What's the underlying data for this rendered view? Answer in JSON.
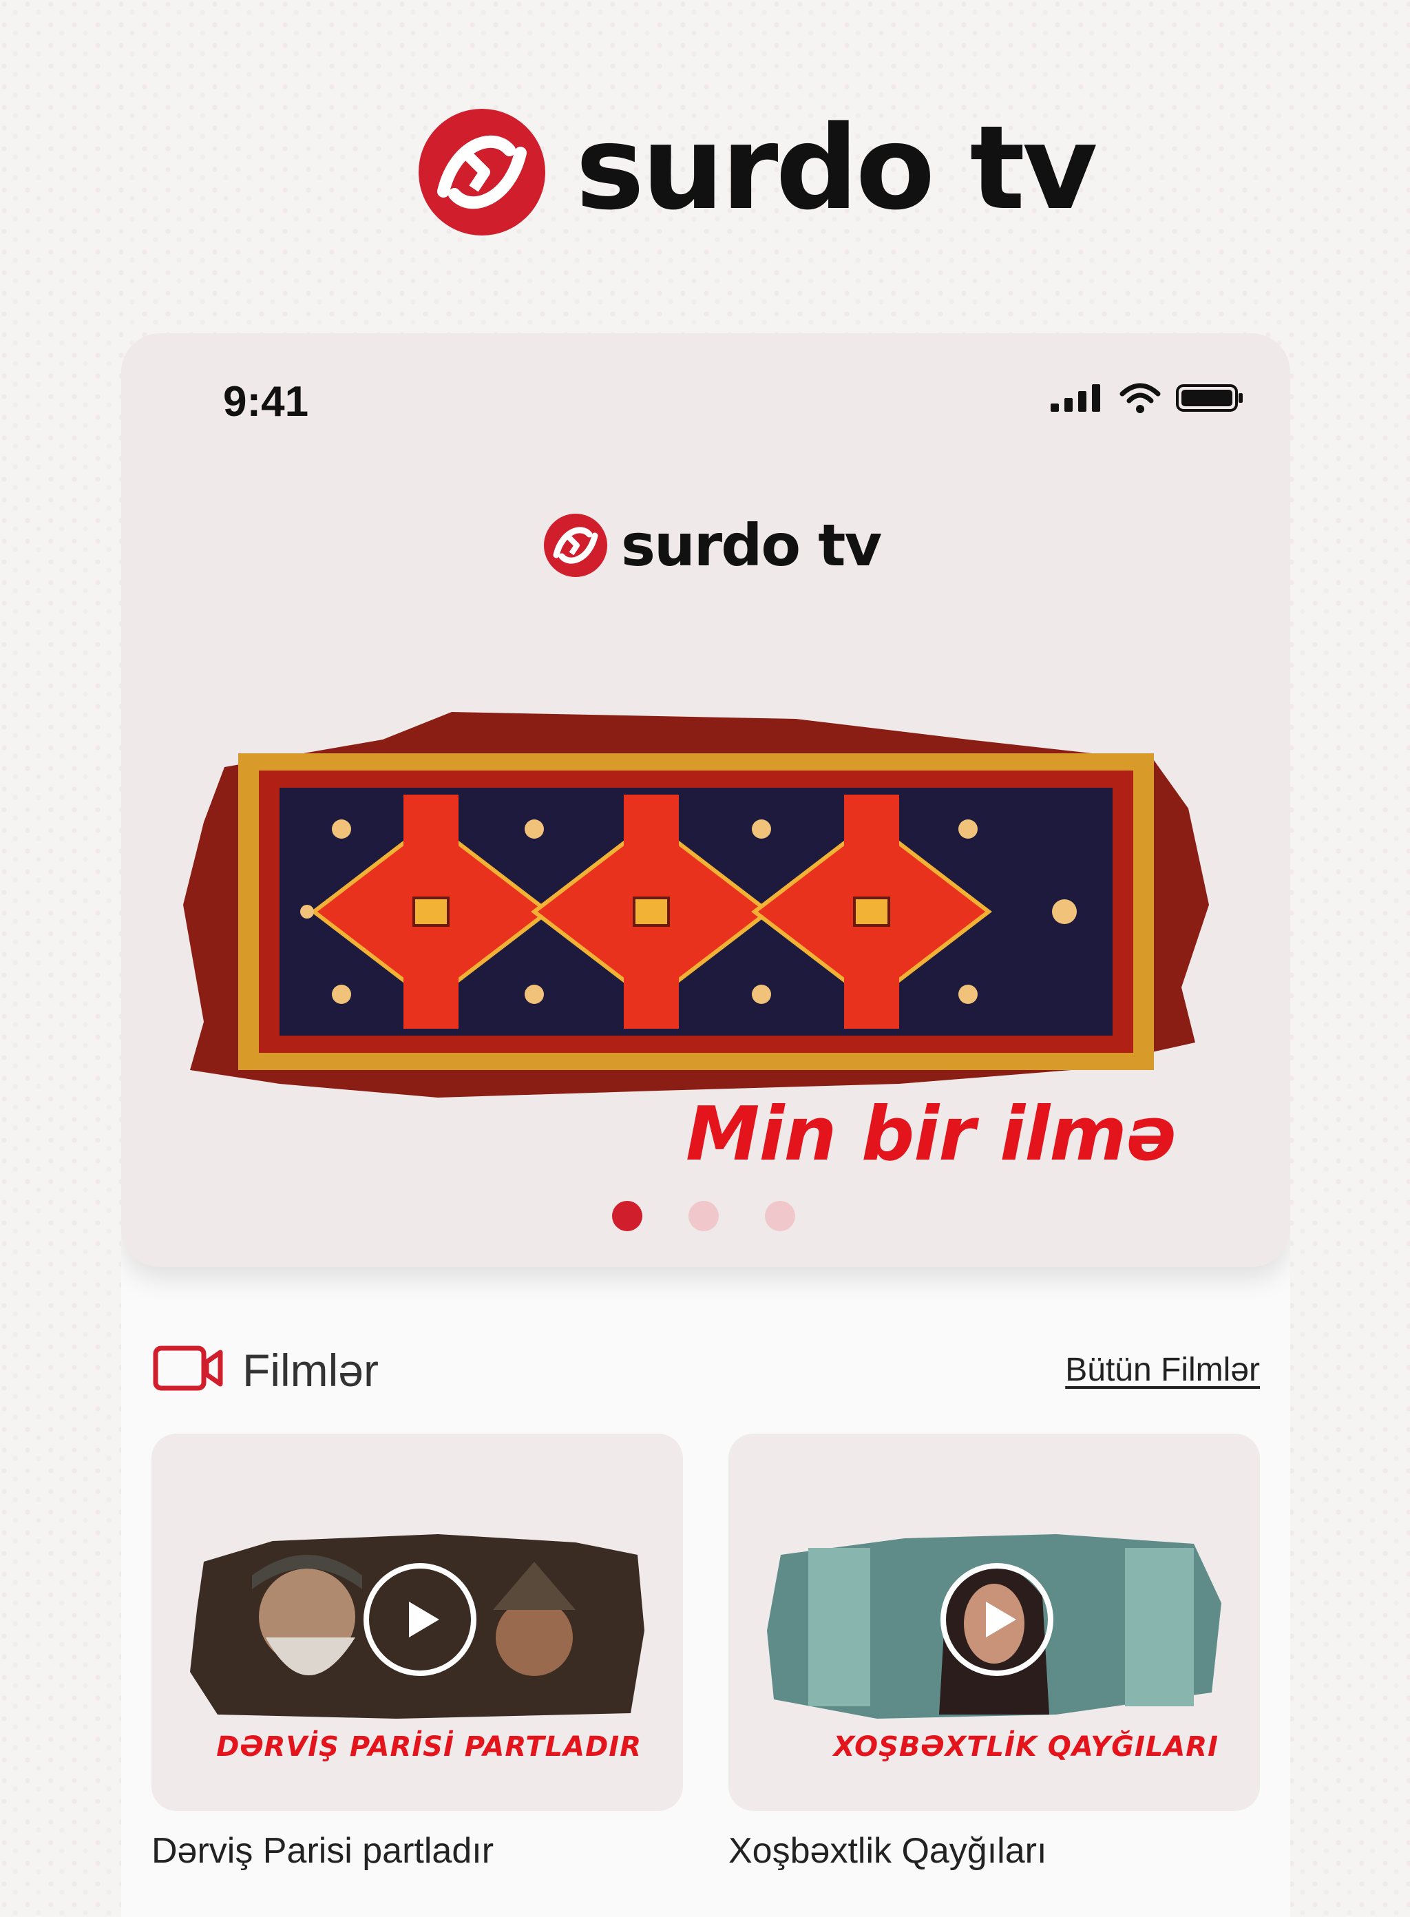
{
  "brand": {
    "name": "surdo tv",
    "accent": "#d01e2c"
  },
  "status_bar": {
    "time": "9:41"
  },
  "hero": {
    "title": "Min bir ilmə",
    "slides_total": 3,
    "active_slide": 1
  },
  "films_section": {
    "title": "Filmlər",
    "see_all_label": "Bütün Filmlər",
    "icon": "video-camera-icon"
  },
  "films": [
    {
      "overlay": "DƏRVİŞ PARİSİ PARTLADIR",
      "caption": "Dərviş Parisi partladır"
    },
    {
      "overlay": "XOŞBƏXTLİK QAYĞILARI",
      "caption": "Xoşbəxtlik Qayğıları"
    }
  ]
}
